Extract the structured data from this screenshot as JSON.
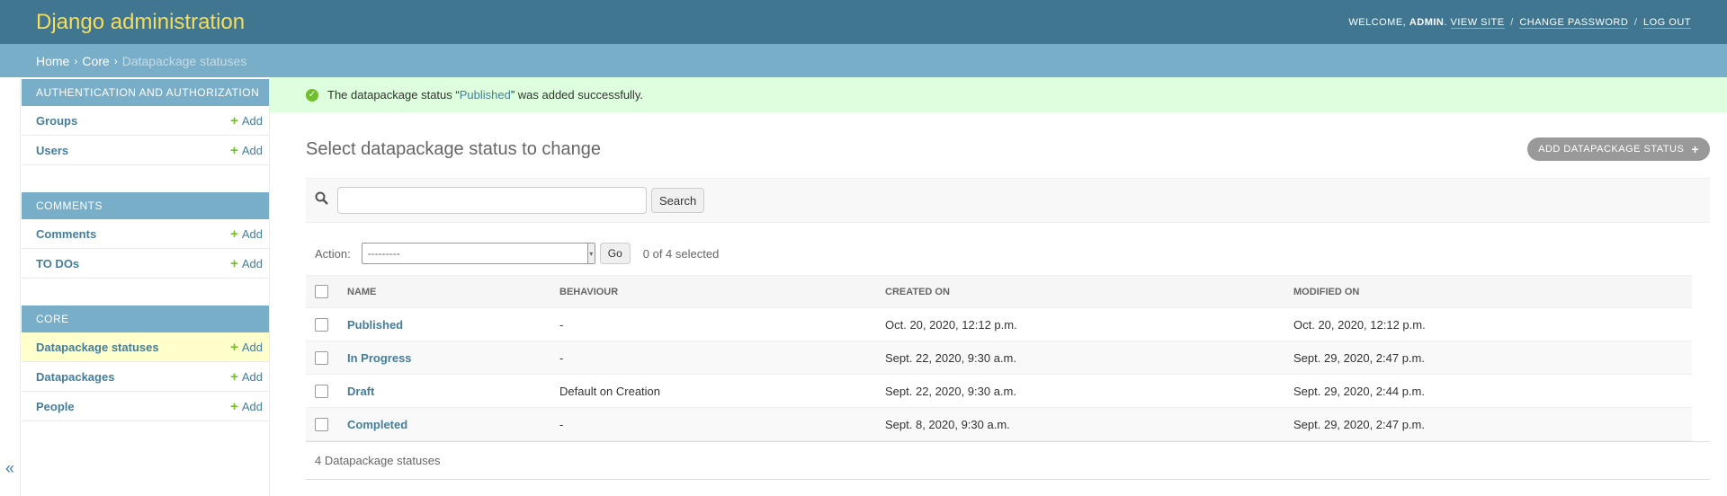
{
  "header": {
    "branding": "Django administration",
    "welcome": "Welcome,",
    "username": "admin",
    "view_site": "View site",
    "change_password": "Change password",
    "log_out": "Log out",
    "sep": "/"
  },
  "breadcrumbs": {
    "home": "Home",
    "core": "Core",
    "current": "Datapackage statuses",
    "arrow": "›"
  },
  "sidebar": {
    "toggle": "«",
    "modules": [
      {
        "caption": "Authentication and Authorization",
        "items": [
          {
            "label": "Groups",
            "add": "Add"
          },
          {
            "label": "Users",
            "add": "Add"
          }
        ]
      },
      {
        "caption": "Comments",
        "items": [
          {
            "label": "Comments",
            "add": "Add"
          },
          {
            "label": "TO DOs",
            "add": "Add"
          }
        ]
      },
      {
        "caption": "Core",
        "items": [
          {
            "label": "Datapackage statuses",
            "add": "Add"
          },
          {
            "label": "Datapackages",
            "add": "Add"
          },
          {
            "label": "People",
            "add": "Add"
          }
        ]
      }
    ]
  },
  "message": {
    "prefix": "The datapackage status “",
    "link": "Published",
    "suffix": "” was added successfully."
  },
  "content": {
    "title": "Select datapackage status to change",
    "add_button": "Add datapackage status",
    "search_button": "Search",
    "search_value": "",
    "action_label": "Action:",
    "action_selected": "---------",
    "go_button": "Go",
    "counter": "0 of 4 selected"
  },
  "table": {
    "headers": [
      "Name",
      "Behaviour",
      "Created on",
      "Modified on"
    ],
    "rows": [
      {
        "name": "Published",
        "behaviour": "-",
        "created": "Oct. 20, 2020, 12:12 p.m.",
        "modified": "Oct. 20, 2020, 12:12 p.m."
      },
      {
        "name": "In Progress",
        "behaviour": "-",
        "created": "Sept. 22, 2020, 9:30 a.m.",
        "modified": "Sept. 29, 2020, 2:47 p.m."
      },
      {
        "name": "Draft",
        "behaviour": "Default on Creation",
        "created": "Sept. 22, 2020, 9:30 a.m.",
        "modified": "Sept. 29, 2020, 2:44 p.m."
      },
      {
        "name": "Completed",
        "behaviour": "-",
        "created": "Sept. 8, 2020, 9:30 a.m.",
        "modified": "Sept. 29, 2020, 2:47 p.m."
      }
    ]
  },
  "paginator": "4 Datapackage statuses",
  "colors": {
    "header_bg": "#417690",
    "branding": "#f5dd5d",
    "breadcrumb_bg": "#79aec8",
    "link": "#447e9b",
    "add_plus": "#70bf2b",
    "success_bg": "#ddffdd",
    "current_row": "#ffffcc"
  }
}
